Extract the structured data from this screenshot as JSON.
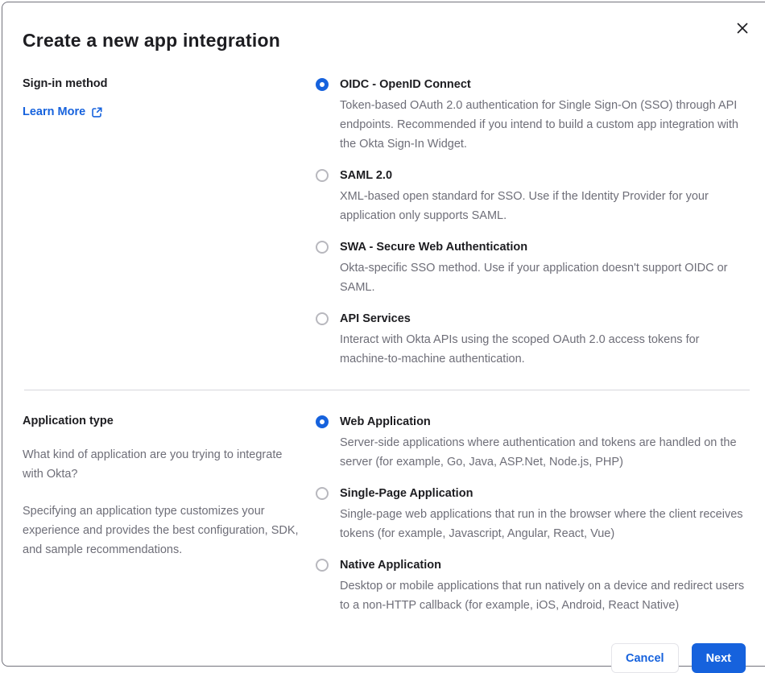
{
  "modal": {
    "title": "Create a new app integration"
  },
  "colors": {
    "accent_blue": "#1662dd",
    "text_dark": "#1d1d21",
    "text_muted": "#6e6e78",
    "divider": "#d7d7dc"
  },
  "icons": {
    "close": "close-icon",
    "external_link": "external-link-icon"
  },
  "sections": [
    {
      "heading": "Sign-in method",
      "link_label": "Learn More",
      "options": [
        {
          "label": "OIDC - OpenID Connect",
          "selected": true,
          "description": "Token-based OAuth 2.0 authentication for Single Sign-On (SSO) through API endpoints. Recommended if you intend to build a custom app integration with the Okta Sign-In Widget."
        },
        {
          "label": "SAML 2.0",
          "selected": false,
          "description": "XML-based open standard for SSO. Use if the Identity Provider for your application only supports SAML."
        },
        {
          "label": "SWA - Secure Web Authentication",
          "selected": false,
          "description": "Okta-specific SSO method. Use if your application doesn't support OIDC or SAML."
        },
        {
          "label": "API Services",
          "selected": false,
          "description": "Interact with Okta APIs using the scoped OAuth 2.0 access tokens for machine-to-machine authentication."
        }
      ]
    },
    {
      "heading": "Application type",
      "paragraphs": [
        "What kind of application are you trying to integrate with Okta?",
        "Specifying an application type customizes your experience and provides the best configuration, SDK, and sample recommendations."
      ],
      "options": [
        {
          "label": "Web Application",
          "selected": true,
          "description": "Server-side applications where authentication and tokens are handled on the server (for example, Go, Java, ASP.Net, Node.js, PHP)"
        },
        {
          "label": "Single-Page Application",
          "selected": false,
          "description": "Single-page web applications that run in the browser where the client receives tokens (for example, Javascript, Angular, React, Vue)"
        },
        {
          "label": "Native Application",
          "selected": false,
          "description": "Desktop or mobile applications that run natively on a device and redirect users to a non-HTTP callback (for example, iOS, Android, React Native)"
        }
      ]
    }
  ],
  "footer": {
    "cancel_label": "Cancel",
    "next_label": "Next"
  }
}
